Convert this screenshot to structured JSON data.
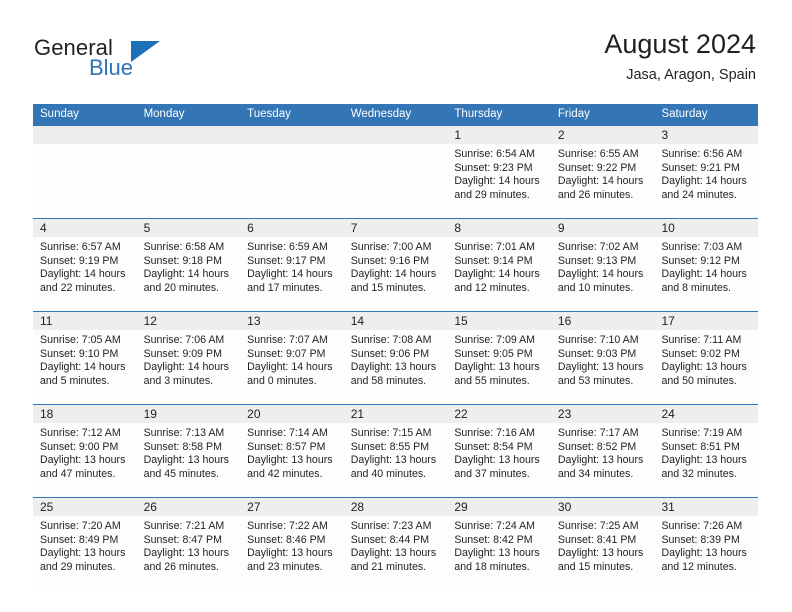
{
  "brand": {
    "name_top": "General",
    "name_bottom": "Blue",
    "accent_color": "#2e72b5",
    "triangle_color": "#1b70b8"
  },
  "header": {
    "title": "August 2024",
    "subtitle": "Jasa, Aragon, Spain"
  },
  "theme": {
    "header_blue": "#3375b5",
    "daynum_band": "#eeeeee",
    "cell_bg": "#fdfdfd",
    "text": "#231f20"
  },
  "calendar": {
    "weekdays": [
      "Sunday",
      "Monday",
      "Tuesday",
      "Wednesday",
      "Thursday",
      "Friday",
      "Saturday"
    ],
    "weeks": [
      [
        {
          "day": "",
          "sunrise": "",
          "sunset": "",
          "daylight1": "",
          "daylight2": ""
        },
        {
          "day": "",
          "sunrise": "",
          "sunset": "",
          "daylight1": "",
          "daylight2": ""
        },
        {
          "day": "",
          "sunrise": "",
          "sunset": "",
          "daylight1": "",
          "daylight2": ""
        },
        {
          "day": "",
          "sunrise": "",
          "sunset": "",
          "daylight1": "",
          "daylight2": ""
        },
        {
          "day": "1",
          "sunrise": "Sunrise: 6:54 AM",
          "sunset": "Sunset: 9:23 PM",
          "daylight1": "Daylight: 14 hours",
          "daylight2": "and 29 minutes."
        },
        {
          "day": "2",
          "sunrise": "Sunrise: 6:55 AM",
          "sunset": "Sunset: 9:22 PM",
          "daylight1": "Daylight: 14 hours",
          "daylight2": "and 26 minutes."
        },
        {
          "day": "3",
          "sunrise": "Sunrise: 6:56 AM",
          "sunset": "Sunset: 9:21 PM",
          "daylight1": "Daylight: 14 hours",
          "daylight2": "and 24 minutes."
        }
      ],
      [
        {
          "day": "4",
          "sunrise": "Sunrise: 6:57 AM",
          "sunset": "Sunset: 9:19 PM",
          "daylight1": "Daylight: 14 hours",
          "daylight2": "and 22 minutes."
        },
        {
          "day": "5",
          "sunrise": "Sunrise: 6:58 AM",
          "sunset": "Sunset: 9:18 PM",
          "daylight1": "Daylight: 14 hours",
          "daylight2": "and 20 minutes."
        },
        {
          "day": "6",
          "sunrise": "Sunrise: 6:59 AM",
          "sunset": "Sunset: 9:17 PM",
          "daylight1": "Daylight: 14 hours",
          "daylight2": "and 17 minutes."
        },
        {
          "day": "7",
          "sunrise": "Sunrise: 7:00 AM",
          "sunset": "Sunset: 9:16 PM",
          "daylight1": "Daylight: 14 hours",
          "daylight2": "and 15 minutes."
        },
        {
          "day": "8",
          "sunrise": "Sunrise: 7:01 AM",
          "sunset": "Sunset: 9:14 PM",
          "daylight1": "Daylight: 14 hours",
          "daylight2": "and 12 minutes."
        },
        {
          "day": "9",
          "sunrise": "Sunrise: 7:02 AM",
          "sunset": "Sunset: 9:13 PM",
          "daylight1": "Daylight: 14 hours",
          "daylight2": "and 10 minutes."
        },
        {
          "day": "10",
          "sunrise": "Sunrise: 7:03 AM",
          "sunset": "Sunset: 9:12 PM",
          "daylight1": "Daylight: 14 hours",
          "daylight2": "and 8 minutes."
        }
      ],
      [
        {
          "day": "11",
          "sunrise": "Sunrise: 7:05 AM",
          "sunset": "Sunset: 9:10 PM",
          "daylight1": "Daylight: 14 hours",
          "daylight2": "and 5 minutes."
        },
        {
          "day": "12",
          "sunrise": "Sunrise: 7:06 AM",
          "sunset": "Sunset: 9:09 PM",
          "daylight1": "Daylight: 14 hours",
          "daylight2": "and 3 minutes."
        },
        {
          "day": "13",
          "sunrise": "Sunrise: 7:07 AM",
          "sunset": "Sunset: 9:07 PM",
          "daylight1": "Daylight: 14 hours",
          "daylight2": "and 0 minutes."
        },
        {
          "day": "14",
          "sunrise": "Sunrise: 7:08 AM",
          "sunset": "Sunset: 9:06 PM",
          "daylight1": "Daylight: 13 hours",
          "daylight2": "and 58 minutes."
        },
        {
          "day": "15",
          "sunrise": "Sunrise: 7:09 AM",
          "sunset": "Sunset: 9:05 PM",
          "daylight1": "Daylight: 13 hours",
          "daylight2": "and 55 minutes."
        },
        {
          "day": "16",
          "sunrise": "Sunrise: 7:10 AM",
          "sunset": "Sunset: 9:03 PM",
          "daylight1": "Daylight: 13 hours",
          "daylight2": "and 53 minutes."
        },
        {
          "day": "17",
          "sunrise": "Sunrise: 7:11 AM",
          "sunset": "Sunset: 9:02 PM",
          "daylight1": "Daylight: 13 hours",
          "daylight2": "and 50 minutes."
        }
      ],
      [
        {
          "day": "18",
          "sunrise": "Sunrise: 7:12 AM",
          "sunset": "Sunset: 9:00 PM",
          "daylight1": "Daylight: 13 hours",
          "daylight2": "and 47 minutes."
        },
        {
          "day": "19",
          "sunrise": "Sunrise: 7:13 AM",
          "sunset": "Sunset: 8:58 PM",
          "daylight1": "Daylight: 13 hours",
          "daylight2": "and 45 minutes."
        },
        {
          "day": "20",
          "sunrise": "Sunrise: 7:14 AM",
          "sunset": "Sunset: 8:57 PM",
          "daylight1": "Daylight: 13 hours",
          "daylight2": "and 42 minutes."
        },
        {
          "day": "21",
          "sunrise": "Sunrise: 7:15 AM",
          "sunset": "Sunset: 8:55 PM",
          "daylight1": "Daylight: 13 hours",
          "daylight2": "and 40 minutes."
        },
        {
          "day": "22",
          "sunrise": "Sunrise: 7:16 AM",
          "sunset": "Sunset: 8:54 PM",
          "daylight1": "Daylight: 13 hours",
          "daylight2": "and 37 minutes."
        },
        {
          "day": "23",
          "sunrise": "Sunrise: 7:17 AM",
          "sunset": "Sunset: 8:52 PM",
          "daylight1": "Daylight: 13 hours",
          "daylight2": "and 34 minutes."
        },
        {
          "day": "24",
          "sunrise": "Sunrise: 7:19 AM",
          "sunset": "Sunset: 8:51 PM",
          "daylight1": "Daylight: 13 hours",
          "daylight2": "and 32 minutes."
        }
      ],
      [
        {
          "day": "25",
          "sunrise": "Sunrise: 7:20 AM",
          "sunset": "Sunset: 8:49 PM",
          "daylight1": "Daylight: 13 hours",
          "daylight2": "and 29 minutes."
        },
        {
          "day": "26",
          "sunrise": "Sunrise: 7:21 AM",
          "sunset": "Sunset: 8:47 PM",
          "daylight1": "Daylight: 13 hours",
          "daylight2": "and 26 minutes."
        },
        {
          "day": "27",
          "sunrise": "Sunrise: 7:22 AM",
          "sunset": "Sunset: 8:46 PM",
          "daylight1": "Daylight: 13 hours",
          "daylight2": "and 23 minutes."
        },
        {
          "day": "28",
          "sunrise": "Sunrise: 7:23 AM",
          "sunset": "Sunset: 8:44 PM",
          "daylight1": "Daylight: 13 hours",
          "daylight2": "and 21 minutes."
        },
        {
          "day": "29",
          "sunrise": "Sunrise: 7:24 AM",
          "sunset": "Sunset: 8:42 PM",
          "daylight1": "Daylight: 13 hours",
          "daylight2": "and 18 minutes."
        },
        {
          "day": "30",
          "sunrise": "Sunrise: 7:25 AM",
          "sunset": "Sunset: 8:41 PM",
          "daylight1": "Daylight: 13 hours",
          "daylight2": "and 15 minutes."
        },
        {
          "day": "31",
          "sunrise": "Sunrise: 7:26 AM",
          "sunset": "Sunset: 8:39 PM",
          "daylight1": "Daylight: 13 hours",
          "daylight2": "and 12 minutes."
        }
      ]
    ]
  }
}
